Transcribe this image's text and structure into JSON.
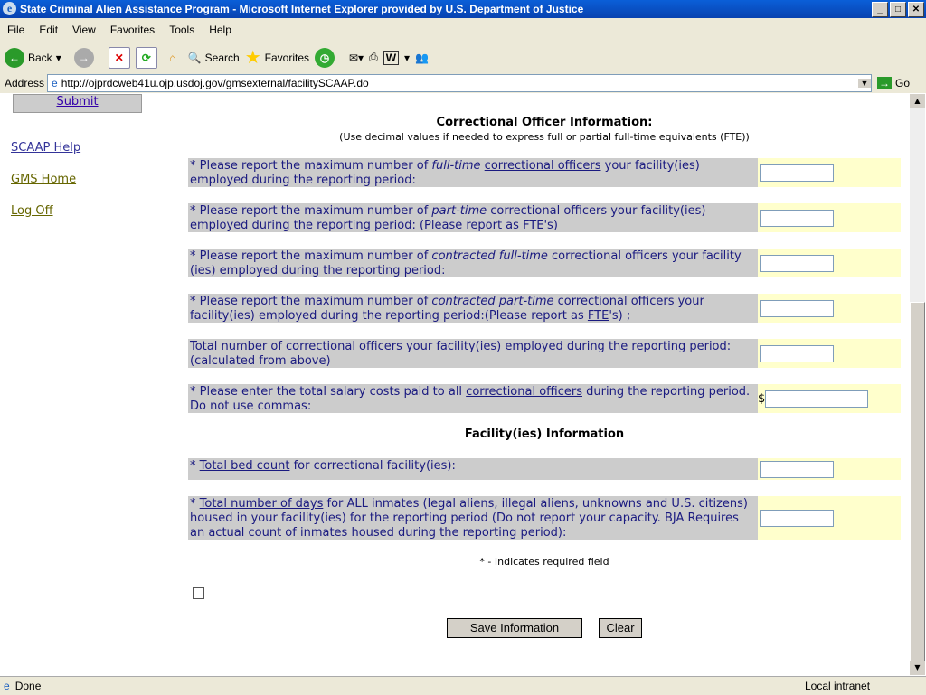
{
  "window": {
    "title": "State Criminal Alien Assistance Program - Microsoft Internet Explorer provided by U.S. Department of Justice"
  },
  "menu": [
    "File",
    "Edit",
    "View",
    "Favorites",
    "Tools",
    "Help"
  ],
  "toolbar": {
    "back": "Back",
    "search": "Search",
    "favorites": "Favorites"
  },
  "address": {
    "label": "Address",
    "url": "http://ojprdcweb41u.ojp.usdoj.gov/gmsexternal/facilitySCAAP.do",
    "go": "Go"
  },
  "sidebar": {
    "submit": "Submit",
    "links": [
      "SCAAP Help",
      "GMS Home",
      "Log Off"
    ]
  },
  "section1": {
    "title": "Correctional Officer Information:",
    "note": "(Use decimal values if needed to express full or partial full-time equivalents (FTE))"
  },
  "rows": [
    {
      "pre": "* Please report the maximum number of ",
      "em": "full-time",
      "mid": " ",
      "link": "correctional officers",
      "post": " your facility(ies) employed during the reporting period:"
    },
    {
      "pre": "* Please report the maximum number of ",
      "em": "part-time",
      "mid": " correctional officers your facility(ies) employed during the reporting period: (Please report as ",
      "link": "FTE",
      "post": "'s)"
    },
    {
      "pre": "* Please report the maximum number of ",
      "em": "contracted full-time",
      "mid": " correctional officers your facility (ies) employed during the reporting period:",
      "link": "",
      "post": ""
    },
    {
      "pre": "* Please report the maximum number of ",
      "em": "contracted part-time",
      "mid": " correctional officers your facility(ies) employed during the reporting period:(Please report as ",
      "link": "FTE",
      "post": "'s) ;"
    },
    {
      "pre": "Total number of correctional officers your facility(ies) employed during the reporting period: (calculated from above)",
      "em": "",
      "mid": "",
      "link": "",
      "post": ""
    },
    {
      "pre": "* Please enter the total salary costs paid to all ",
      "em": "",
      "mid": "",
      "link": "correctional officers",
      "post": " during the reporting period. Do not use commas:",
      "currency": "$"
    }
  ],
  "section2": {
    "title": "Facility(ies) Information"
  },
  "rows2": [
    {
      "pre": "* ",
      "link": "Total bed count",
      "post": " for correctional facility(ies):"
    },
    {
      "pre": "* ",
      "link": "Total number of days",
      "post": " for ALL inmates (legal aliens, illegal aliens, unknowns and U.S. citizens) housed in your facility(ies) for the reporting period (Do not report your capacity. BJA Requires an actual count of inmates housed during the reporting period):"
    }
  ],
  "required_note": "* - Indicates required field",
  "buttons": {
    "save": "Save Information",
    "clear": "Clear"
  },
  "status": {
    "text": "Done",
    "zone": "Local intranet"
  }
}
